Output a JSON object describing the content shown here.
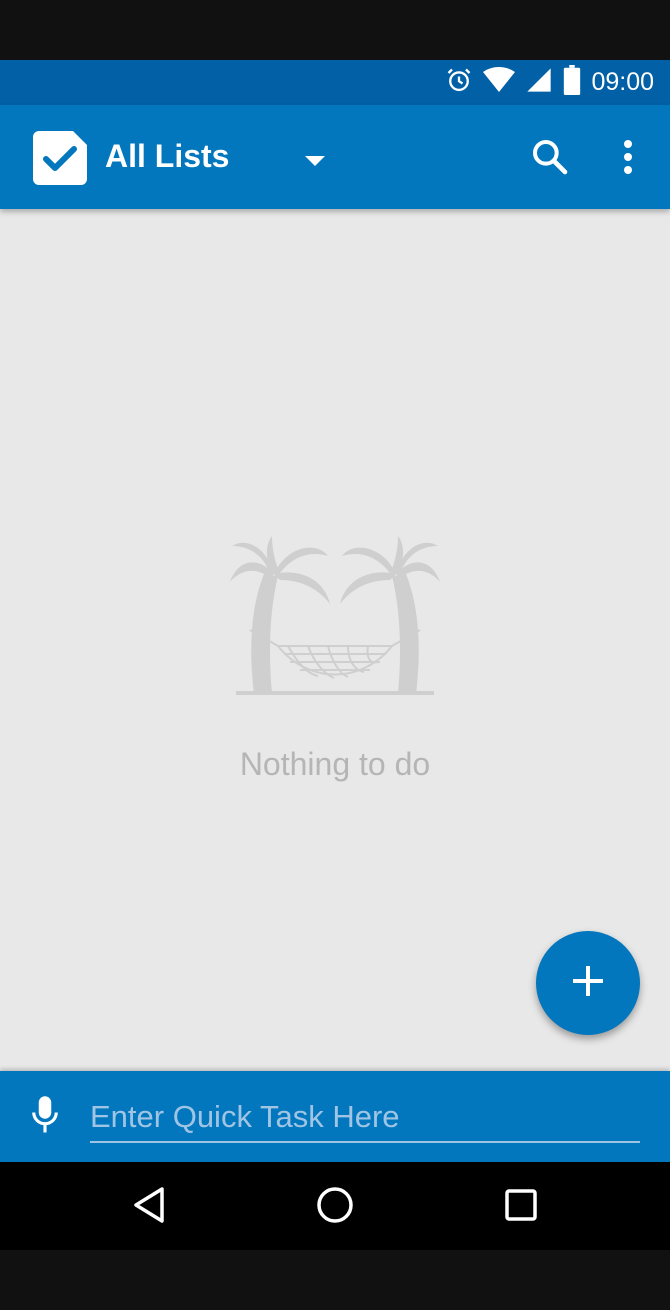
{
  "status_bar": {
    "time": "09:00",
    "icons": [
      "alarm-icon",
      "wifi-icon",
      "signal-icon",
      "battery-icon"
    ]
  },
  "app_bar": {
    "title": "All Lists",
    "logo_icon": "checkbox-logo-icon",
    "actions": [
      "dropdown-arrow-icon",
      "search-icon",
      "more-vert-icon"
    ]
  },
  "empty_state": {
    "illustration": "palm-trees-hammock-illustration",
    "message": "Nothing to do"
  },
  "fab": {
    "icon": "add-icon"
  },
  "quick_task": {
    "placeholder": "Enter Quick Task Here",
    "value": "",
    "mic_icon": "microphone-icon"
  },
  "nav_bar": {
    "buttons": [
      "back-icon",
      "home-icon",
      "recents-icon"
    ]
  },
  "colors": {
    "primary": "#0277bd",
    "status_bar": "#0160a6",
    "background": "#e8e8e8",
    "muted_text": "#b5b5b5"
  }
}
